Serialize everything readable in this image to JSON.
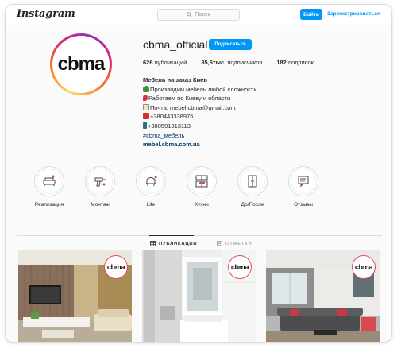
{
  "header": {
    "logo": "Instagram",
    "search_placeholder": "Поиск",
    "login_label": "Войти",
    "register_label": "Зарегистрироваться"
  },
  "profile": {
    "avatar_text": "cbma",
    "username": "cbma_official",
    "follow_label": "Подписаться",
    "stats": {
      "posts_count": "626",
      "posts_label": "публикаций",
      "followers_count": "85,6тыс.",
      "followers_label": "подписчиков",
      "following_count": "182",
      "following_label": "подписок"
    },
    "bio": {
      "name": "Мебель на заказ Киев",
      "lines": [
        "Производим мебель любой сложности",
        "Работаем по Киеву и области",
        "Почта: mebel.cbma@gmail.com",
        "+380443338976",
        "+380501313113"
      ],
      "hashtag": "#cbma_мебель",
      "website": "mebel.cbma.com.ua"
    }
  },
  "highlights": [
    {
      "label": "Реализация",
      "icon": "sofa-icon"
    },
    {
      "label": "Монтаж",
      "icon": "drill-icon"
    },
    {
      "label": "Life",
      "icon": "armchair-icon"
    },
    {
      "label": "Кухни",
      "icon": "kitchen-icon"
    },
    {
      "label": "До/После",
      "icon": "door-icon"
    },
    {
      "label": "Отзывы",
      "icon": "comment-icon"
    }
  ],
  "tabs": {
    "posts_label": "ПУБЛИКАЦИИ",
    "tagged_label": "ОТМЕТКИ"
  },
  "posts": [
    {
      "logo": "cbma",
      "scene": "living-room-tv"
    },
    {
      "logo": "cbma",
      "scene": "bathroom-mirror"
    },
    {
      "logo": "cbma",
      "scene": "living-room-sofa"
    }
  ],
  "colors": {
    "accent": "#0095f6",
    "ring_pink": "#d62976",
    "link": "#00376b"
  }
}
